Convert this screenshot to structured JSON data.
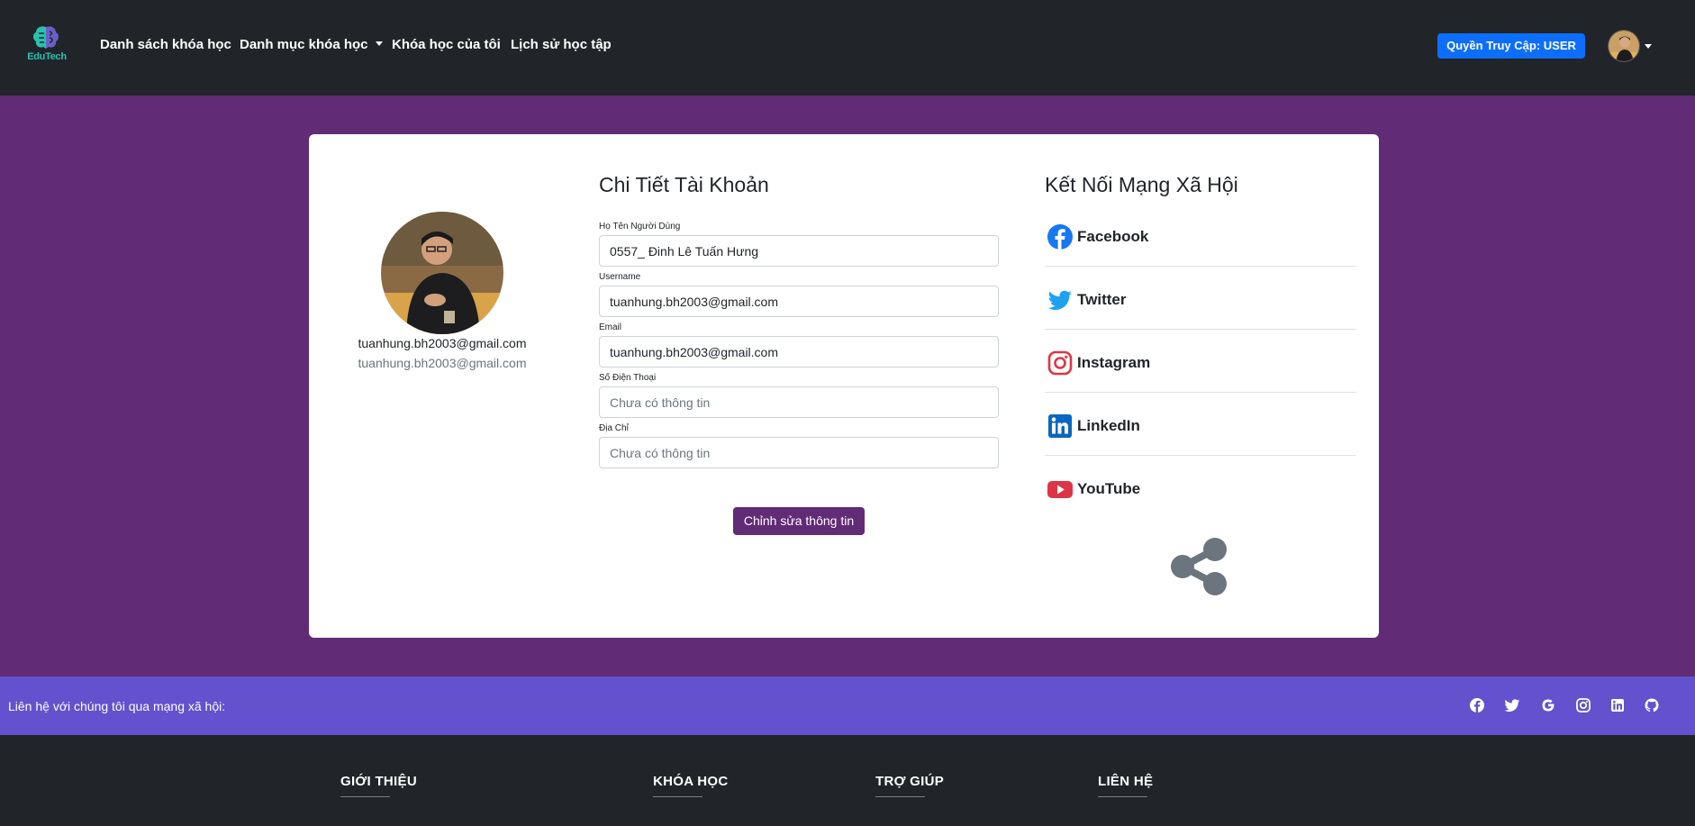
{
  "brand": {
    "name": "EduTech"
  },
  "nav": {
    "links": [
      {
        "label": "Danh sách khóa học"
      },
      {
        "label": "Danh mục khóa học"
      },
      {
        "label": "Khóa học của tôi"
      },
      {
        "label": "Lịch sử học tập"
      }
    ],
    "access_button": "Quyền Truy Cập: USER"
  },
  "profile": {
    "name": "tuanhung.bh2003@gmail.com",
    "email": "tuanhung.bh2003@gmail.com"
  },
  "account": {
    "title": "Chi Tiết Tài Khoản",
    "fields": [
      {
        "label": "Họ Tên Người Dùng",
        "value": "0557_ Đinh Lê Tuấn Hưng",
        "placeholder": ""
      },
      {
        "label": "Username",
        "value": "tuanhung.bh2003@gmail.com",
        "placeholder": ""
      },
      {
        "label": "Email",
        "value": "tuanhung.bh2003@gmail.com",
        "placeholder": ""
      },
      {
        "label": "Số Điện Thoại",
        "value": "",
        "placeholder": "Chưa có thông tin"
      },
      {
        "label": "Địa Chỉ",
        "value": "",
        "placeholder": "Chưa có thông tin"
      }
    ],
    "edit_button": "Chỉnh sửa thông tin"
  },
  "social": {
    "title": "Kết Nối Mạng Xã Hội",
    "items": [
      {
        "label": "Facebook",
        "icon": "facebook-icon",
        "color": "#1877f2"
      },
      {
        "label": "Twitter",
        "icon": "twitter-icon",
        "color": "#1da1f2"
      },
      {
        "label": "Instagram",
        "icon": "instagram-icon",
        "color": "#dc3545"
      },
      {
        "label": "LinkedIn",
        "icon": "linkedin-icon",
        "color": "#0a66c2"
      },
      {
        "label": "YouTube",
        "icon": "youtube-icon",
        "color": "#dc3545"
      }
    ]
  },
  "contact_bar": {
    "text": "Liên hệ với chúng tôi qua mạng xã hội:",
    "icons": [
      "facebook-icon",
      "twitter-icon",
      "google-icon",
      "instagram-icon",
      "linkedin-icon",
      "github-icon"
    ]
  },
  "footer": {
    "headings": [
      "GIỚI THIỆU",
      "KHÓA HỌC",
      "TRỢ GIÚP",
      "LIÊN HỆ"
    ]
  },
  "colors": {
    "navbar": "#212529",
    "page_bg": "#612b76",
    "primary": "#0d6efd",
    "edit_button": "#612b76",
    "contact_bar": "#6351ce"
  }
}
